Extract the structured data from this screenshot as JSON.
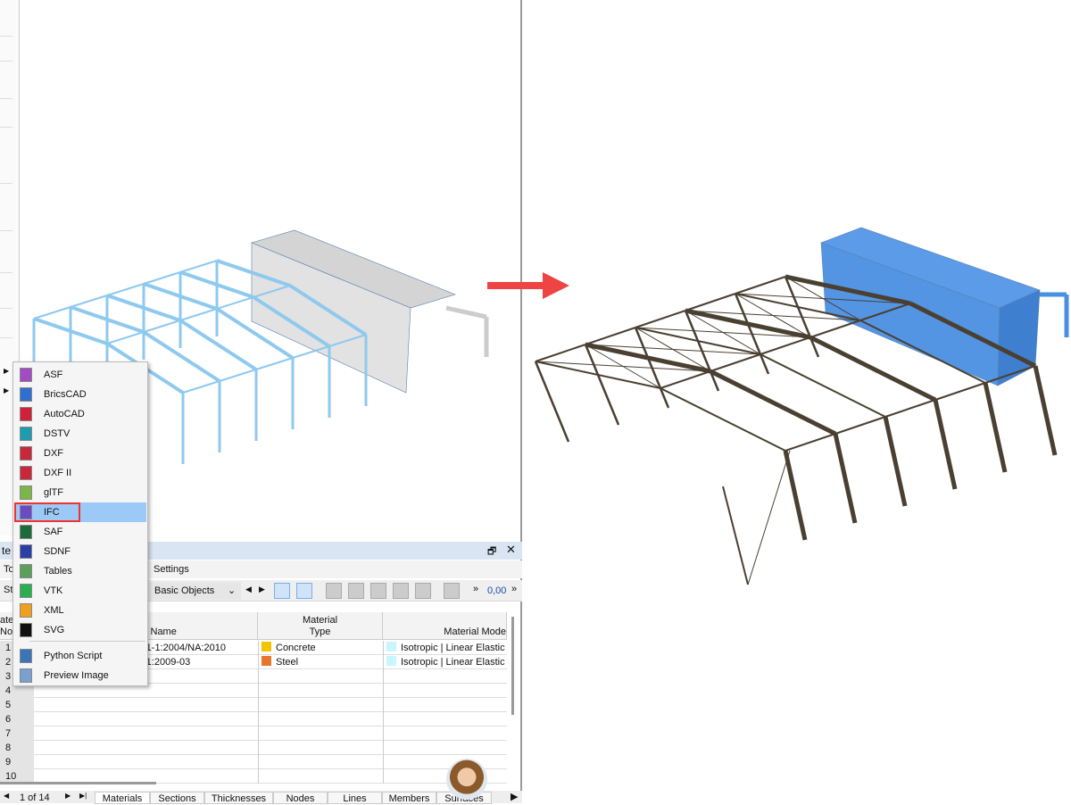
{
  "export_menu": {
    "items": [
      {
        "label": "ASF",
        "icon": "asf-file-icon",
        "color": "#a24bc2"
      },
      {
        "label": "BricsCAD",
        "icon": "bricscad-file-icon",
        "color": "#2f6fd0"
      },
      {
        "label": "AutoCAD",
        "icon": "autocad-file-icon",
        "color": "#d0203a"
      },
      {
        "label": "DSTV",
        "icon": "dstv-file-icon",
        "color": "#1f9bb0"
      },
      {
        "label": "DXF",
        "icon": "dxf-file-icon",
        "color": "#c8283a"
      },
      {
        "label": "DXF II",
        "icon": "dxf2-file-icon",
        "color": "#c8283a"
      },
      {
        "label": "glTF",
        "icon": "gltf-file-icon",
        "color": "#7ab648"
      },
      {
        "label": "IFC",
        "icon": "ifc-file-icon",
        "color": "#6b4bc2"
      },
      {
        "label": "SAF",
        "icon": "saf-file-icon",
        "color": "#1d6b3a"
      },
      {
        "label": "SDNF",
        "icon": "sdnf-file-icon",
        "color": "#2a3fa8"
      },
      {
        "label": "Tables",
        "icon": "tables-file-icon",
        "color": "#5aa05a"
      },
      {
        "label": "VTK",
        "icon": "vtk-file-icon",
        "color": "#28b050"
      },
      {
        "label": "XML",
        "icon": "xml-file-icon",
        "color": "#f0a020"
      },
      {
        "label": "SVG",
        "icon": "svg-file-icon",
        "color": "#111111"
      }
    ],
    "extra": [
      {
        "label": "Python Script",
        "icon": "python-icon"
      },
      {
        "label": "Preview Image",
        "icon": "preview-image-icon"
      }
    ],
    "selected": "IFC"
  },
  "panel": {
    "title_fragment": "te",
    "menu": [
      "To",
      "Settings"
    ],
    "toolbar": {
      "left_fragment": "St",
      "filter": "Basic Objects",
      "decimal": "0,00"
    },
    "columns": {
      "no": "ate\nNo",
      "name": "l Name",
      "type": "Material\nType",
      "model": "Material Mode"
    },
    "rows": [
      {
        "no": "1",
        "name": "-1-1:2004/NA:2010",
        "type": "Concrete",
        "type_color": "#f5c400",
        "model": "Isotropic | Linear Elastic",
        "model_color": "#c8f6ff"
      },
      {
        "no": "2",
        "name": "-1:2009-03",
        "type": "Steel",
        "type_color": "#e8752e",
        "model": "Isotropic | Linear Elastic",
        "model_color": "#c8f6ff"
      },
      {
        "no": "3"
      },
      {
        "no": "4"
      },
      {
        "no": "5"
      },
      {
        "no": "6"
      },
      {
        "no": "7"
      },
      {
        "no": "8"
      },
      {
        "no": "9"
      },
      {
        "no": "10"
      }
    ],
    "pager": "1 of 14",
    "tabs": [
      "Materials",
      "Sections",
      "Thicknesses",
      "Nodes",
      "Lines",
      "Members",
      "Surfaces"
    ]
  },
  "colors": {
    "arrow": "#ee4444",
    "highlight": "#9cc9f6",
    "left_model": "#8ec9ee",
    "right_frame": "#4a4032",
    "right_blue": "#4a90e2"
  }
}
